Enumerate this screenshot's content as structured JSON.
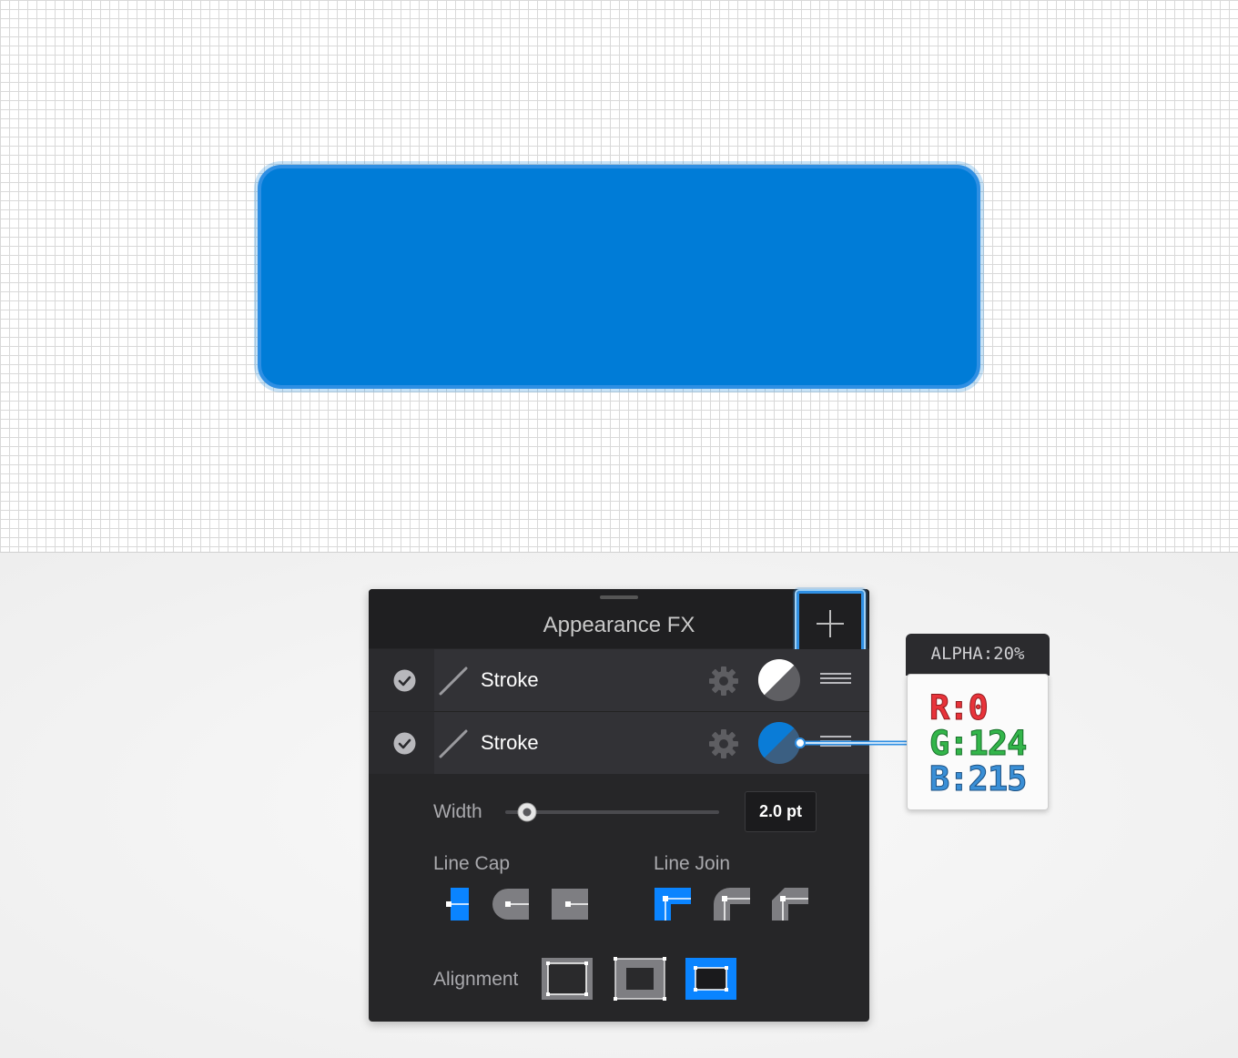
{
  "canvas": {
    "shape_fill": "#007CD7",
    "shape_stroke": "#2F8FE3",
    "grid_color": "#D9D9D9"
  },
  "panel": {
    "title": "Appearance FX",
    "add_icon": "plus-icon",
    "rows": [
      {
        "label": "Stroke",
        "checked": true,
        "swatch": "white-grey-split",
        "icons": [
          "check-icon",
          "stroke-slash-icon",
          "gear-icon",
          "color-swatch-icon",
          "drag-handle-icon"
        ]
      },
      {
        "label": "Stroke",
        "checked": true,
        "swatch": "blue-split",
        "icons": [
          "check-icon",
          "stroke-slash-icon",
          "gear-icon",
          "color-swatch-icon",
          "drag-handle-icon"
        ]
      }
    ],
    "width": {
      "label": "Width",
      "value": "2.0 pt",
      "slider_fraction": 0.1
    },
    "line_cap": {
      "label": "Line Cap",
      "options": [
        "butt-cap",
        "round-cap",
        "projecting-cap"
      ],
      "selected": "butt-cap"
    },
    "line_join": {
      "label": "Line Join",
      "options": [
        "miter-join",
        "round-join",
        "bevel-join"
      ],
      "selected": "miter-join"
    },
    "alignment": {
      "label": "Alignment",
      "options": [
        "align-inside",
        "align-center",
        "align-outside"
      ],
      "selected": "align-outside"
    },
    "accent": "#0A84FF"
  },
  "tooltip": {
    "alpha": "ALPHA:20%",
    "r": "R:0",
    "g": "G:124",
    "b": "B:215"
  }
}
